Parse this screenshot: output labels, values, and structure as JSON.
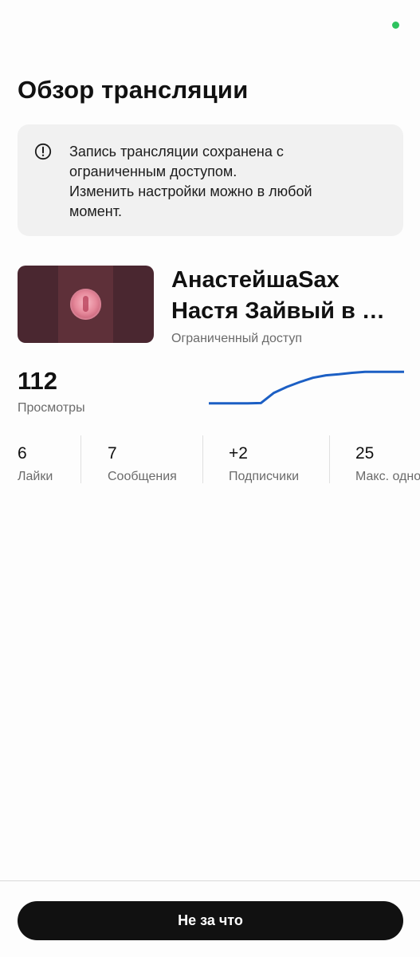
{
  "status": {
    "indicator_color": "#2ec35f"
  },
  "page": {
    "title": "Обзор трансляции"
  },
  "notice": {
    "icon": "info-circle-icon",
    "lines": [
      "Запись трансляции сохранена с",
      "ограниченным доступом.",
      "Изменить настройки можно в любой",
      "момент."
    ]
  },
  "stream": {
    "title_lines": [
      "АнастейшаSax",
      "Настя Зайвый в …"
    ],
    "access": "Ограниченный доступ",
    "thumbnail": "stream-thumbnail"
  },
  "views": {
    "value": "112",
    "label": "Просмотры",
    "trend_color": "#1c5fc4",
    "trend_points": [
      0.05,
      0.05,
      0.05,
      0.05,
      0.06,
      0.35,
      0.52,
      0.66,
      0.78,
      0.85,
      0.88,
      0.92,
      0.95,
      0.95,
      0.95,
      0.95
    ]
  },
  "stats": [
    {
      "value": "6",
      "label": "Лайки"
    },
    {
      "value": "7",
      "label": "Сообщения"
    },
    {
      "value": "+2",
      "label": "Подписчики"
    },
    {
      "value": "25",
      "label": "Макс. однов"
    }
  ],
  "footer": {
    "button_label": "Не за что"
  }
}
